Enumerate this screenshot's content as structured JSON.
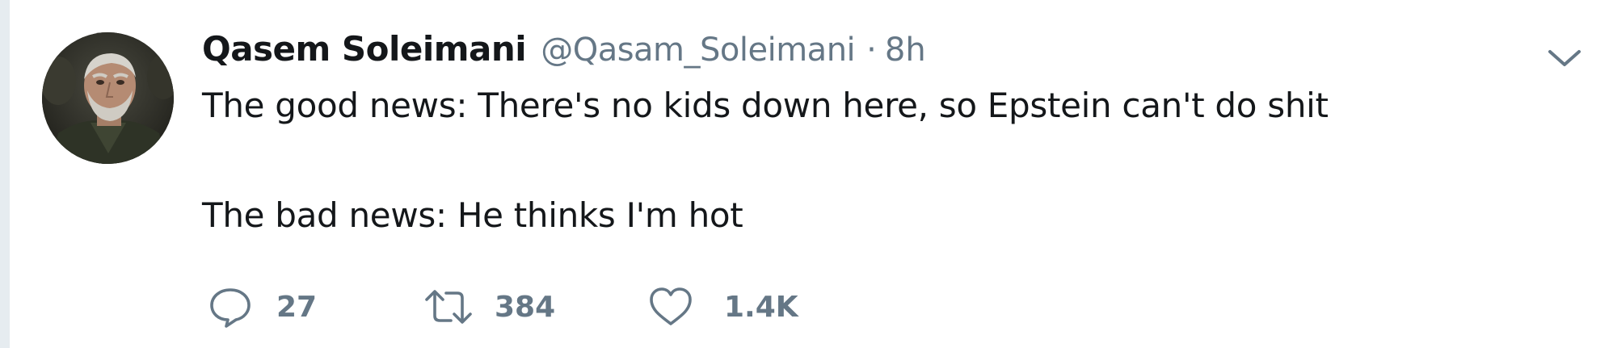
{
  "tweet": {
    "author": {
      "name": "Qasem Soleimani",
      "handle": "@Qasam_Soleimani",
      "separator": "·",
      "time": "8h"
    },
    "text_lines": [
      "The good news: There's no kids down here, so Epstein can't do shit",
      "The bad news: He thinks I'm hot"
    ],
    "actions": {
      "reply": {
        "icon": "reply-icon",
        "count": "27"
      },
      "retweet": {
        "icon": "retweet-icon",
        "count": "384"
      },
      "like": {
        "icon": "heart-icon",
        "count": "1.4K"
      }
    },
    "menu_icon": "chevron-down-icon"
  },
  "colors": {
    "text": "#14171a",
    "secondary": "#657786",
    "rail": "#e6ecf0"
  }
}
